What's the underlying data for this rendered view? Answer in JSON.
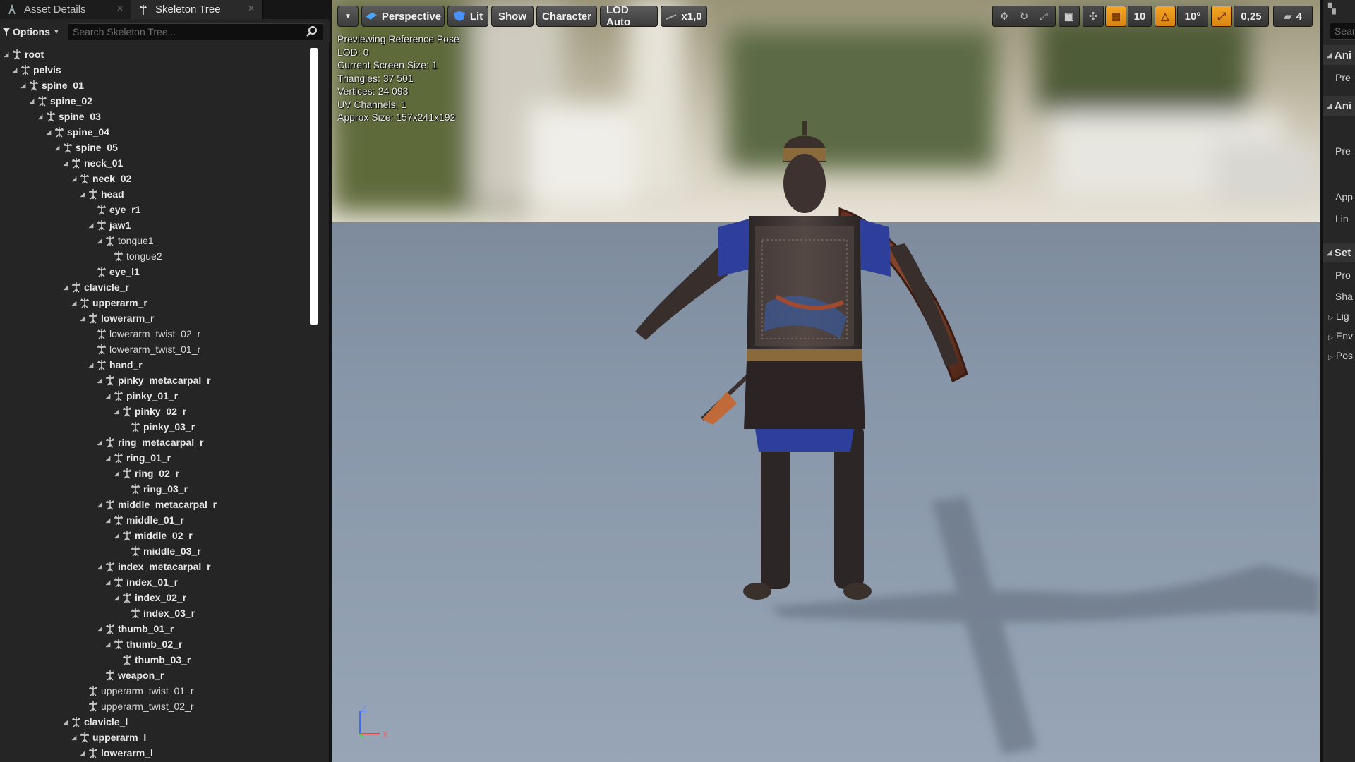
{
  "tabs": [
    {
      "label": "Asset Details",
      "active": false
    },
    {
      "label": "Skeleton Tree",
      "active": true
    }
  ],
  "filter": {
    "options_label": "Options",
    "search_placeholder": "Search Skeleton Tree..."
  },
  "tree": [
    {
      "name": "root",
      "depth": 0,
      "expanded": true,
      "bold": true
    },
    {
      "name": "pelvis",
      "depth": 1,
      "expanded": true,
      "bold": true
    },
    {
      "name": "spine_01",
      "depth": 2,
      "expanded": true,
      "bold": true
    },
    {
      "name": "spine_02",
      "depth": 3,
      "expanded": true,
      "bold": true
    },
    {
      "name": "spine_03",
      "depth": 4,
      "expanded": true,
      "bold": true
    },
    {
      "name": "spine_04",
      "depth": 5,
      "expanded": true,
      "bold": true
    },
    {
      "name": "spine_05",
      "depth": 6,
      "expanded": true,
      "bold": true
    },
    {
      "name": "neck_01",
      "depth": 7,
      "expanded": true,
      "bold": true
    },
    {
      "name": "neck_02",
      "depth": 8,
      "expanded": true,
      "bold": true
    },
    {
      "name": "head",
      "depth": 9,
      "expanded": true,
      "bold": true
    },
    {
      "name": "eye_r1",
      "depth": 10,
      "expanded": false,
      "bold": true
    },
    {
      "name": "jaw1",
      "depth": 10,
      "expanded": true,
      "bold": true
    },
    {
      "name": "tongue1",
      "depth": 11,
      "expanded": true,
      "bold": false
    },
    {
      "name": "tongue2",
      "depth": 12,
      "expanded": false,
      "bold": false
    },
    {
      "name": "eye_l1",
      "depth": 10,
      "expanded": false,
      "bold": true
    },
    {
      "name": "clavicle_r",
      "depth": 7,
      "expanded": true,
      "bold": true
    },
    {
      "name": "upperarm_r",
      "depth": 8,
      "expanded": true,
      "bold": true
    },
    {
      "name": "lowerarm_r",
      "depth": 9,
      "expanded": true,
      "bold": true
    },
    {
      "name": "lowerarm_twist_02_r",
      "depth": 10,
      "expanded": false,
      "bold": false
    },
    {
      "name": "lowerarm_twist_01_r",
      "depth": 10,
      "expanded": false,
      "bold": false
    },
    {
      "name": "hand_r",
      "depth": 10,
      "expanded": true,
      "bold": true
    },
    {
      "name": "pinky_metacarpal_r",
      "depth": 11,
      "expanded": true,
      "bold": true
    },
    {
      "name": "pinky_01_r",
      "depth": 12,
      "expanded": true,
      "bold": true
    },
    {
      "name": "pinky_02_r",
      "depth": 13,
      "expanded": true,
      "bold": true
    },
    {
      "name": "pinky_03_r",
      "depth": 14,
      "expanded": false,
      "bold": true
    },
    {
      "name": "ring_metacarpal_r",
      "depth": 11,
      "expanded": true,
      "bold": true
    },
    {
      "name": "ring_01_r",
      "depth": 12,
      "expanded": true,
      "bold": true
    },
    {
      "name": "ring_02_r",
      "depth": 13,
      "expanded": true,
      "bold": true
    },
    {
      "name": "ring_03_r",
      "depth": 14,
      "expanded": false,
      "bold": true
    },
    {
      "name": "middle_metacarpal_r",
      "depth": 11,
      "expanded": true,
      "bold": true
    },
    {
      "name": "middle_01_r",
      "depth": 12,
      "expanded": true,
      "bold": true
    },
    {
      "name": "middle_02_r",
      "depth": 13,
      "expanded": true,
      "bold": true
    },
    {
      "name": "middle_03_r",
      "depth": 14,
      "expanded": false,
      "bold": true
    },
    {
      "name": "index_metacarpal_r",
      "depth": 11,
      "expanded": true,
      "bold": true
    },
    {
      "name": "index_01_r",
      "depth": 12,
      "expanded": true,
      "bold": true
    },
    {
      "name": "index_02_r",
      "depth": 13,
      "expanded": true,
      "bold": true
    },
    {
      "name": "index_03_r",
      "depth": 14,
      "expanded": false,
      "bold": true
    },
    {
      "name": "thumb_01_r",
      "depth": 11,
      "expanded": true,
      "bold": true
    },
    {
      "name": "thumb_02_r",
      "depth": 12,
      "expanded": true,
      "bold": true
    },
    {
      "name": "thumb_03_r",
      "depth": 13,
      "expanded": false,
      "bold": true
    },
    {
      "name": "weapon_r",
      "depth": 11,
      "expanded": false,
      "bold": true
    },
    {
      "name": "upperarm_twist_01_r",
      "depth": 9,
      "expanded": false,
      "bold": false
    },
    {
      "name": "upperarm_twist_02_r",
      "depth": 9,
      "expanded": false,
      "bold": false
    },
    {
      "name": "clavicle_l",
      "depth": 7,
      "expanded": true,
      "bold": true
    },
    {
      "name": "upperarm_l",
      "depth": 8,
      "expanded": true,
      "bold": true
    },
    {
      "name": "lowerarm_l",
      "depth": 9,
      "expanded": true,
      "bold": true
    }
  ],
  "viewport": {
    "toolbar": {
      "perspective": "Perspective",
      "lit": "Lit",
      "show": "Show",
      "character": "Character",
      "lod": "LOD Auto",
      "speed": "x1,0"
    },
    "info_lines": [
      "Previewing Reference Pose",
      "LOD: 0",
      "Current Screen Size: 1",
      "Triangles: 37 501",
      "Vertices: 24 093",
      "UV Channels: 1",
      "Approx Size: 157x241x192"
    ],
    "right_tools": {
      "grid_snap": "10",
      "rotation_snap": "10°",
      "scale_snap": "0,25",
      "camera_speed": "4"
    },
    "axis": {
      "z": "Z",
      "x": "X"
    }
  },
  "right_panel": {
    "search_placeholder": "Sear",
    "sections": [
      "Ani",
      "Ani",
      "Set"
    ],
    "items": [
      "Pre",
      "Pre",
      "App",
      "Lin",
      "Pro",
      "Sha"
    ],
    "subsections": [
      "Lig",
      "Env",
      "Pos"
    ]
  },
  "colors": {
    "accent_orange": "#f5a623",
    "panel_bg": "#252525",
    "viewport_floor": "#8c9bad",
    "axis_z": "#3b6cff",
    "axis_x": "#ff3a3a"
  }
}
